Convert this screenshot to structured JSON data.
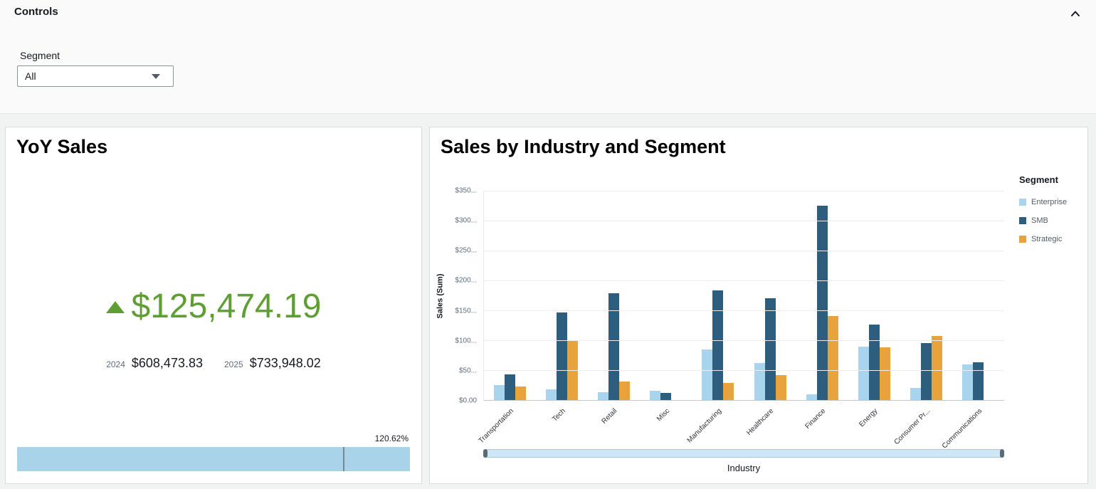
{
  "controls": {
    "title": "Controls",
    "segment_label": "Segment",
    "segment_value": "All"
  },
  "kpi": {
    "title": "YoY Sales",
    "value": "$125,474.19",
    "trend": "up",
    "trend_color": "#5f9e32",
    "comparisons": [
      {
        "year": "2024",
        "value": "$608,473.83"
      },
      {
        "year": "2025",
        "value": "$733,948.02"
      }
    ],
    "progress_label": "120.62%",
    "progress_marker_percent": 83,
    "progress_color": "#a9d3e9"
  },
  "chart": {
    "title": "Sales by Industry and Segment",
    "legend_title": "Segment",
    "ylabel": "Sales (Sum)",
    "xlabel": "Industry",
    "y_tick_labels": [
      "$350...",
      "$300...",
      "$250...",
      "$200...",
      "$150...",
      "$100...",
      "$50...",
      "$0.00"
    ]
  },
  "chart_data": {
    "type": "bar",
    "title": "Sales by Industry and Segment",
    "xlabel": "Industry",
    "ylabel": "Sales (Sum)",
    "ylim": [
      0,
      350
    ],
    "grid": true,
    "legend_position": "right",
    "categories": [
      "Transportation",
      "Tech",
      "Retail",
      "Misc",
      "Manufacturing",
      "Healthcare",
      "Finance",
      "Energy",
      "Consumer Pr...",
      "Communications"
    ],
    "series": [
      {
        "name": "Enterprise",
        "color": "#a9d4ee",
        "values": [
          25,
          18,
          13,
          15,
          84,
          62,
          10,
          89,
          20,
          59
        ]
      },
      {
        "name": "SMB",
        "color": "#2e5e7e",
        "values": [
          43,
          146,
          178,
          12,
          183,
          170,
          325,
          126,
          95,
          63
        ]
      },
      {
        "name": "Strategic",
        "color": "#e8a33d",
        "values": [
          23,
          99,
          31,
          0,
          28,
          42,
          140,
          88,
          107,
          0
        ]
      }
    ]
  }
}
